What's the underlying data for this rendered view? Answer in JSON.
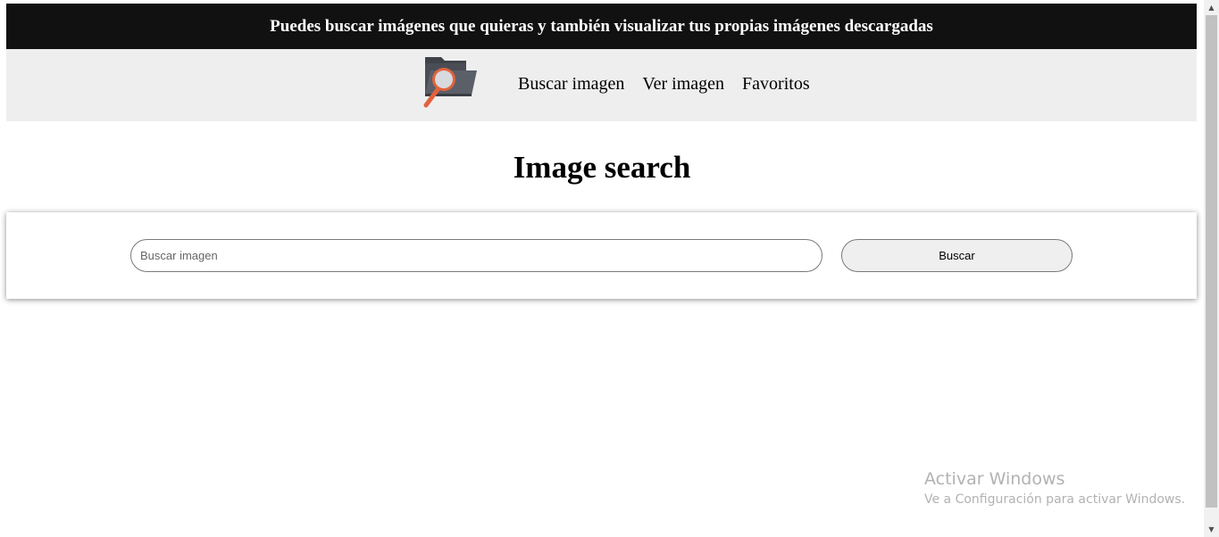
{
  "banner": {
    "text": "Puedes buscar imágenes que quieras y también visualizar tus propias imágenes descargadas"
  },
  "nav": {
    "logo_icon": "folder-magnifier-icon",
    "links": [
      "Buscar imagen",
      "Ver imagen",
      "Favoritos"
    ]
  },
  "main": {
    "title": "Image search"
  },
  "search": {
    "placeholder": "Buscar imagen",
    "value": "",
    "button_label": "Buscar"
  },
  "watermark": {
    "title": "Activar Windows",
    "subtitle": "Ve a Configuración para activar Windows."
  },
  "colors": {
    "banner_bg": "#111111",
    "nav_bg": "#efeeef",
    "folder": "#4a4d55",
    "magnifier": "#e2623c"
  }
}
